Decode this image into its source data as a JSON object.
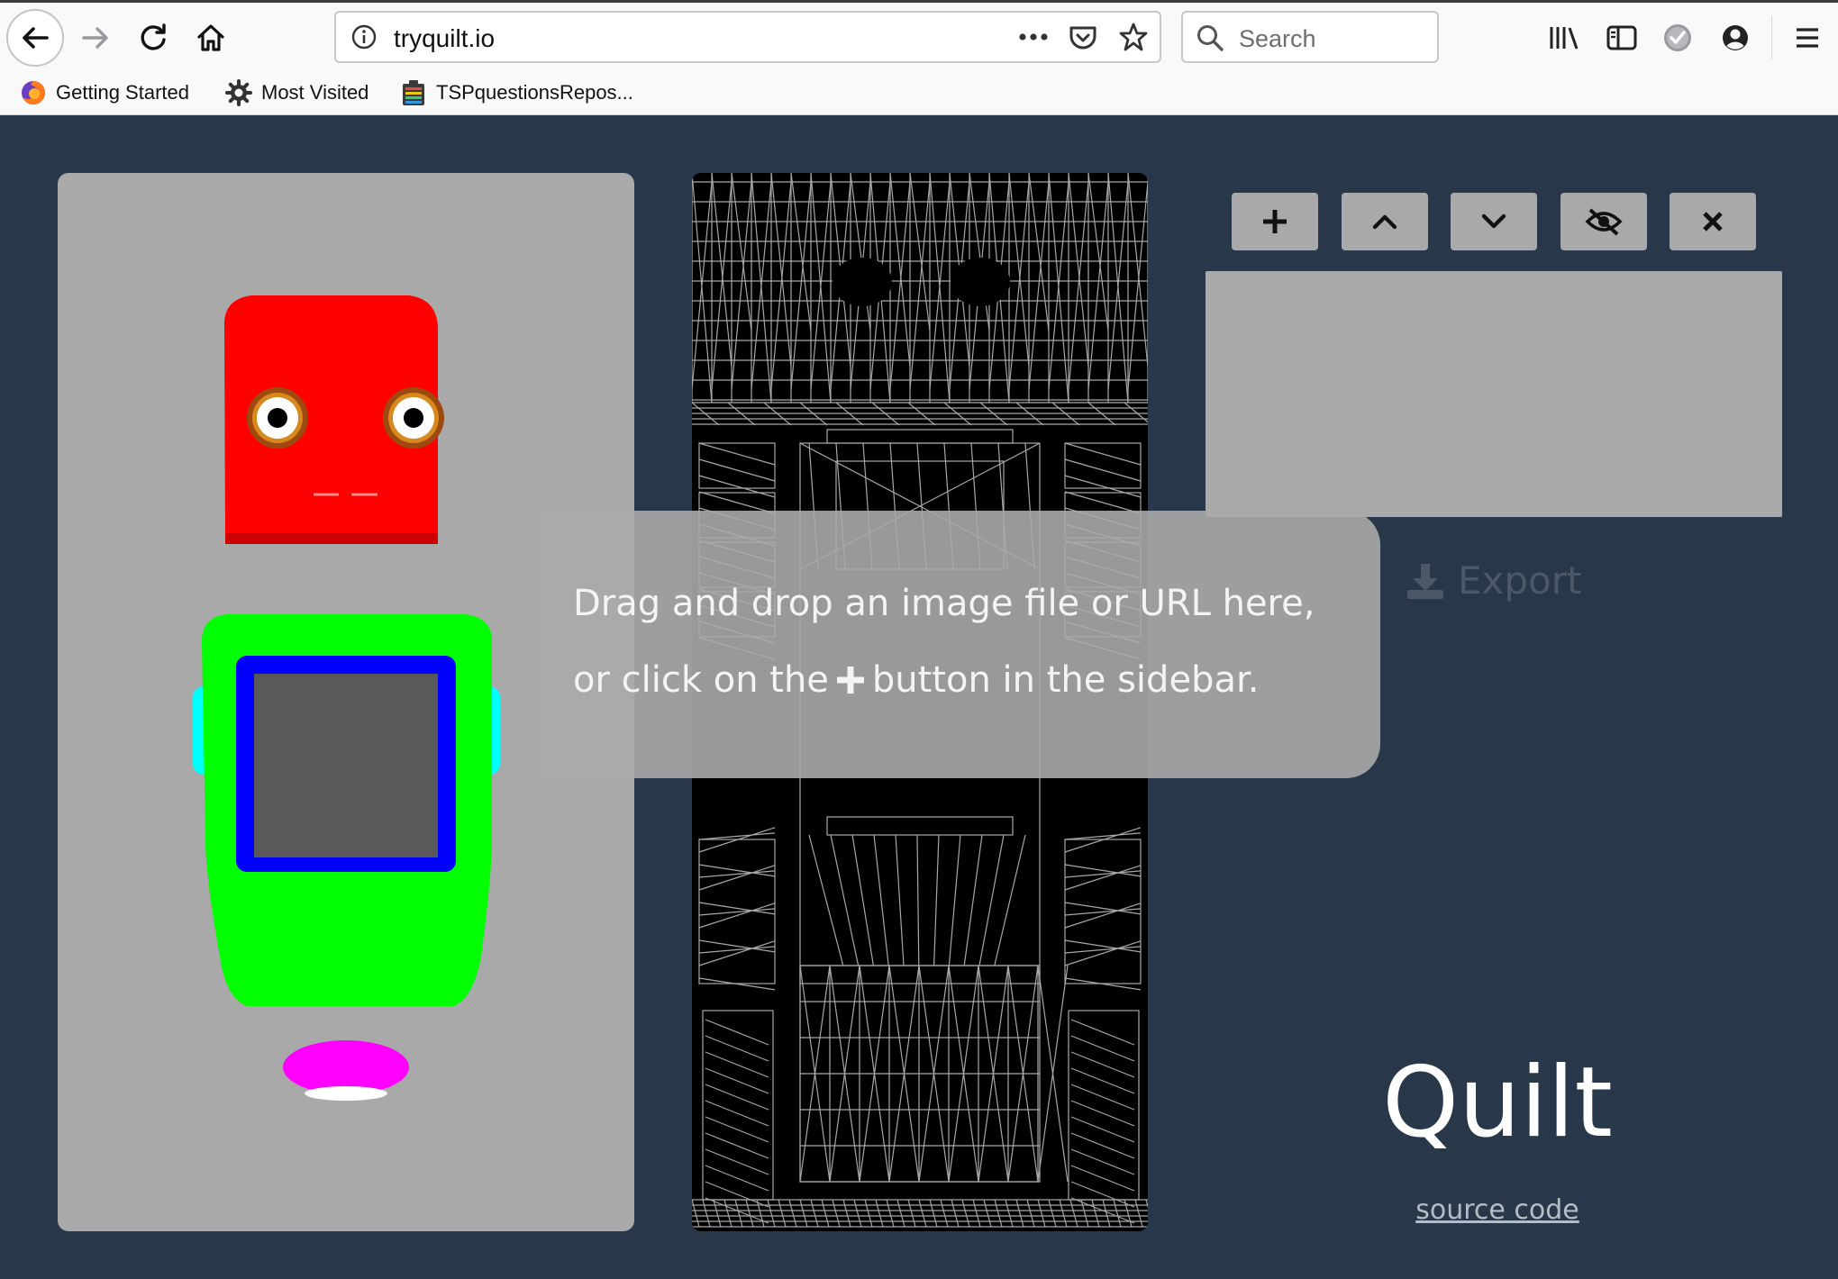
{
  "browser": {
    "url": "tryquilt.io",
    "search_placeholder": "Search",
    "bookmarks": [
      {
        "label": "Getting Started",
        "icon": "firefox-icon"
      },
      {
        "label": "Most Visited",
        "icon": "gear-icon"
      },
      {
        "label": "TSPquestionsRepos...",
        "icon": "bookmark-page-icon"
      }
    ],
    "toolbar_icons": [
      "back-icon",
      "forward-icon",
      "reload-icon",
      "home-icon",
      "info-icon",
      "more-icon",
      "pocket-icon",
      "star-icon",
      "library-icon",
      "sidebar-icon",
      "extension-icon",
      "account-icon",
      "menu-icon"
    ]
  },
  "sidebar": {
    "buttons": [
      "add-icon",
      "move-up-icon",
      "move-down-icon",
      "hide-icon",
      "remove-icon"
    ],
    "export_label": "Export"
  },
  "overlay": {
    "line1": "Drag and drop an image file or URL here,",
    "line2_before": "or click on the",
    "line2_after": "button in the sidebar."
  },
  "app": {
    "title": "Quilt",
    "source_link": "source code"
  },
  "colors": {
    "page_bg": "#29374a",
    "panel_gray": "#a9a9a9",
    "head_red": "#ff0000",
    "body_green": "#00ff00",
    "screen_border_blue": "#0000ff",
    "screen_gray": "#595959",
    "base_magenta": "#ff00ff",
    "arm_cyan": "#00ffff"
  }
}
